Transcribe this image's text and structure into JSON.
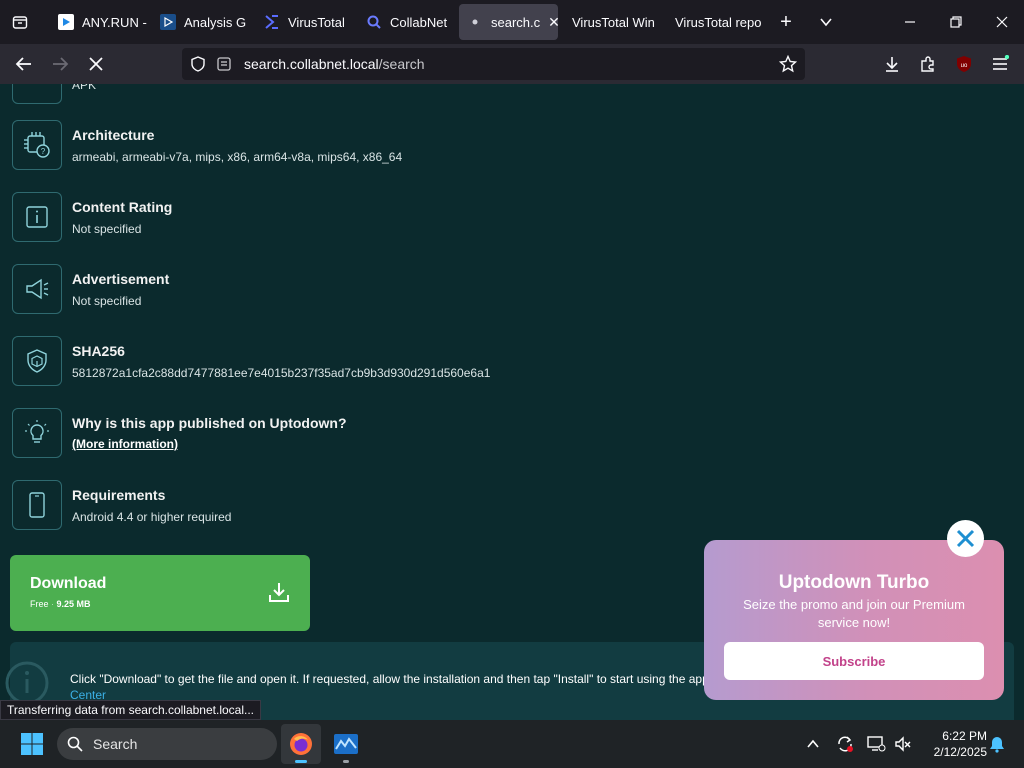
{
  "browser": {
    "tabs": [
      {
        "title": "ANY.RUN -",
        "icon": "anyrun-icon"
      },
      {
        "title": "Analysis G",
        "icon": "analysis-icon"
      },
      {
        "title": "VirusTotal",
        "icon": "virustotal-icon"
      },
      {
        "title": "CollabNet",
        "icon": "search-icon"
      },
      {
        "title": "search.c",
        "icon": "loading-dot-icon",
        "active": true
      },
      {
        "title": "VirusTotal Win",
        "icon": ""
      },
      {
        "title": "VirusTotal repo",
        "icon": ""
      }
    ],
    "url_host": "search.collabnet.local",
    "url_path": "/search",
    "status_text": "Transferring data from search.collabnet.local..."
  },
  "page": {
    "partial_top_text": "APK",
    "details": [
      {
        "title": "Architecture",
        "value": "armeabi, armeabi-v7a, mips, x86, arm64-v8a, mips64, x86_64",
        "icon": "chip-question-icon"
      },
      {
        "title": "Content Rating",
        "value": "Not specified",
        "icon": "info-icon"
      },
      {
        "title": "Advertisement",
        "value": "Not specified",
        "icon": "megaphone-icon"
      },
      {
        "title": "SHA256",
        "value": "5812872a1cfa2c88dd7477881ee7e4015b237f35ad7cb9b3d930d291d560e6a1",
        "icon": "shield-cube-icon"
      },
      {
        "title": "Why is this app published on Uptodown?",
        "link": "(More information)",
        "icon": "lightbulb-icon"
      },
      {
        "title": "Requirements",
        "value": "Android 4.4 or higher required",
        "icon": "phone-icon"
      }
    ],
    "download": {
      "label": "Download",
      "free": "Free",
      "size": "9.25 MB"
    },
    "info_text": "Click \"Download\" to get the file and open it. If requested, allow the installation and then tap \"Install\" to start using the app.",
    "info_link": "Center"
  },
  "promo": {
    "title": "Uptodown Turbo",
    "description": "Seize the promo and join our Premium service now!",
    "button": "Subscribe"
  },
  "taskbar": {
    "search_label": "Search",
    "time": "6:22 PM",
    "date": "2/12/2025"
  },
  "colors": {
    "accent_green": "#4caf50",
    "page_bg": "#0b2a2d",
    "promo_pink": "#d190b8"
  }
}
